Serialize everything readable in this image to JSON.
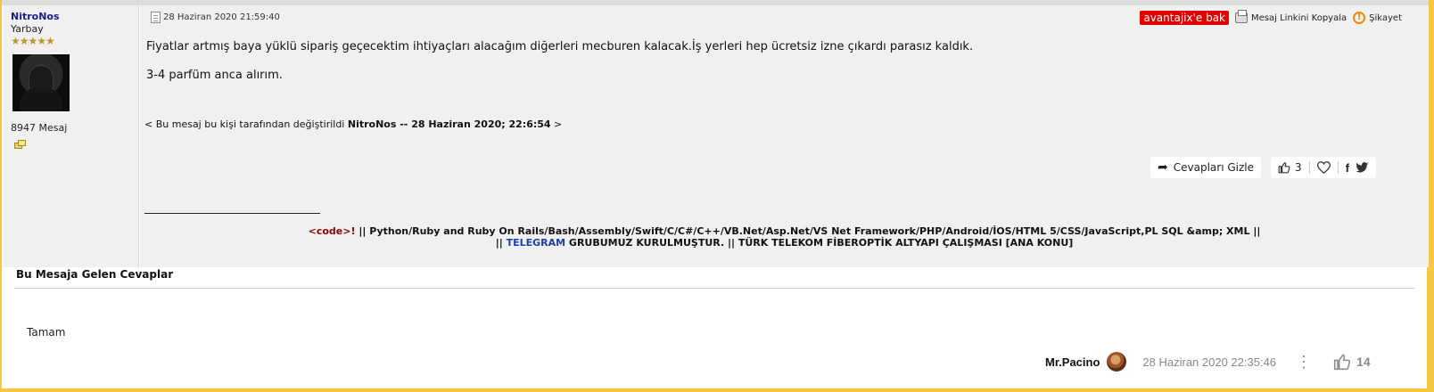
{
  "author": {
    "name": "NitroNos",
    "rank": "Yarbay",
    "stars": "★★★★★",
    "message_count": "8947 Mesaj"
  },
  "post": {
    "date": "28 Haziran 2020 21:59:40",
    "ad_badge": "avantajix'e bak",
    "copy_link": "Mesaj Linkini Kopyala",
    "complain": "Şikayet",
    "paragraphs": [
      "Fiyatlar artmış baya yüklü sipariş geçecektim ihtiyaçları alacağım diğerleri mecburen kalacak.İş yerleri hep ücretsiz izne çıkardı parasız kaldık.",
      "3-4 parfüm anca alırım."
    ],
    "edit_note": {
      "prefix": "< Bu mesaj bu kişi tarafından değiştirildi ",
      "editor": "NitroNos -- 28 Haziran 2020; 22:6:54",
      "suffix": " >"
    },
    "hide_replies": "Cevapları Gizle",
    "like_count": "3"
  },
  "signature": {
    "code": "<code>!",
    "line1": " || Python/Ruby and Ruby On Rails/Bash/Assembly/Swift/C/C#/C++/VB.Net/Asp.Net/VS Net Framework/PHP/Android/İOS/HTML 5/CSS/JavaScript,PL SQL &amp; XML ||",
    "line2_prefix": "|| ",
    "telegram": "TELEGRAM",
    "line2_rest": " GRUBUMUZ KURULMUŞTUR. || TÜRK TELEKOM FİBEROPTİK ALTYAPI ÇALIŞMASI [ANA KONU]"
  },
  "replies": {
    "title": "Bu Mesaja Gelen Cevaplar",
    "items": [
      {
        "text": "Tamam",
        "user": "Mr.Pacino",
        "date": "28 Haziran 2020 22:35:46",
        "likes": "14"
      }
    ]
  },
  "colors": {
    "accent_border": "#f5c842",
    "ad_badge_bg": "#e00000",
    "author_name": "#1a1a8c",
    "telegram_link": "#1e3ea8",
    "code_tag": "#8b0000"
  }
}
